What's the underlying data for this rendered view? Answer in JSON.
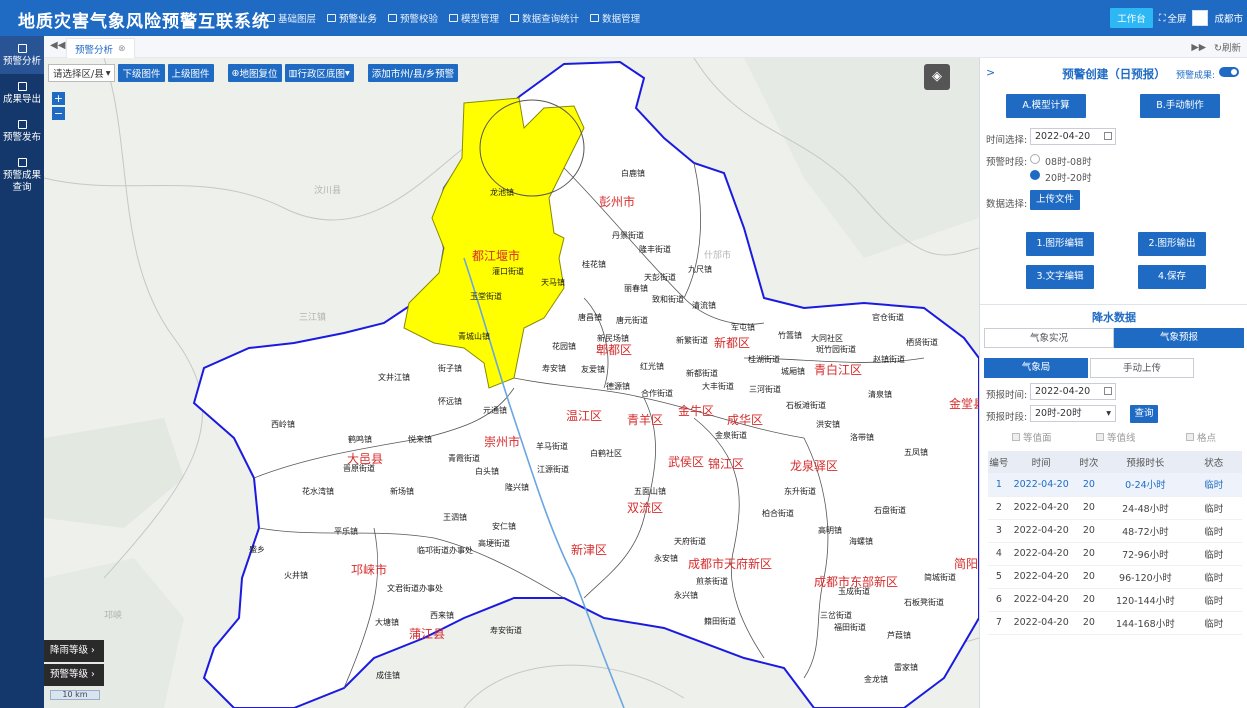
{
  "header": {
    "title": "地质灾害气象风险预警互联系统",
    "nav": [
      {
        "label": "基础图层",
        "icon": "layers-icon"
      },
      {
        "label": "预警业务",
        "icon": "chart-icon",
        "active": true
      },
      {
        "label": "预警校验",
        "icon": "document-icon"
      },
      {
        "label": "模型管理",
        "icon": "model-icon"
      },
      {
        "label": "数据查询统计",
        "icon": "query-icon"
      },
      {
        "label": "数据管理",
        "icon": "database-icon"
      }
    ],
    "workbench": "工作台",
    "fullscreen": "全屏",
    "user": "成都市"
  },
  "sidebar": {
    "items": [
      {
        "label": "预警分析",
        "icon": "analysis-icon",
        "active": true
      },
      {
        "label": "成果导出",
        "icon": "export-icon"
      },
      {
        "label": "预警发布",
        "icon": "publish-icon"
      },
      {
        "label": "预警成果查询",
        "icon": "search-result-icon"
      }
    ]
  },
  "tabs": {
    "active": "预警分析",
    "refresh": "刷新"
  },
  "map_toolbar": {
    "region_select": "请选择区/县",
    "down_level": "下级图件",
    "up_level": "上级图件",
    "reset": "地图复位",
    "basemap": "行政区底图",
    "add_warning": "添加市州/县/乡预警"
  },
  "legend": {
    "rain_level": "降雨等级",
    "warning_level": "预警等级",
    "scale": "10 km"
  },
  "map_labels": {
    "cities": [
      "彭州市",
      "都江堰市",
      "郫都区",
      "新都区",
      "青白江区",
      "金堂县",
      "温江区",
      "金牛区",
      "青羊区",
      "成华区",
      "崇州市",
      "大邑县",
      "武侯区",
      "锦江区",
      "龙泉驿区",
      "双流区",
      "新津区",
      "邛崃市",
      "成都市天府新区",
      "成都市东部新区",
      "蒲江县",
      "简阳"
    ],
    "towns": [
      "龙池镇",
      "白鹿镇",
      "丹景街道",
      "隆丰街道",
      "九尺镇",
      "天彭街道",
      "灌口街道",
      "天马镇",
      "玉堂街道",
      "青城山镇",
      "丽春镇",
      "致和街道",
      "桂花镇",
      "清流镇",
      "军屯镇",
      "唐昌镇",
      "唐元街道",
      "新民场镇",
      "花园镇",
      "新繁街道",
      "竹篙镇",
      "大同社区",
      "官仓街道",
      "斑竹园街道",
      "桂湖街道",
      "城厢镇",
      "赵镇街道",
      "栖贤街道",
      "文井江镇",
      "街子镇",
      "寿安镇",
      "友爱镇",
      "红光镇",
      "德源镇",
      "三河街道",
      "大丰街道",
      "新都街道",
      "石板滩街道",
      "清泉镇",
      "怀远镇",
      "元通镇",
      "合作街道",
      "金泉街道",
      "洪安镇",
      "洛带镇",
      "西岭镇",
      "鹤鸣镇",
      "悦来镇",
      "羊马街道",
      "白鹤社区",
      "晋原街道",
      "青霞街道",
      "白头镇",
      "江源街道",
      "新场镇",
      "花水湾镇",
      "王泗镇",
      "隆兴镇",
      "安仁镇",
      "东升街道",
      "柏合街道",
      "平乐镇",
      "临邛街道办事处",
      "文君街道办事处",
      "高埂街道",
      "火井镇",
      "大塘镇",
      "西来镇",
      "寿安街道",
      "成佳镇",
      "永安镇",
      "煎茶街道",
      "籍田街道",
      "天府街道",
      "五凤镇",
      "高明镇",
      "海螺镇",
      "三岔街道",
      "玉成街道",
      "福田街道",
      "芦葭镇",
      "石板凳街道",
      "雷家镇",
      "石盘街道",
      "简城街道",
      "永兴镇",
      "金龙镇",
      "盛乡",
      "五面山镇"
    ],
    "outside": [
      "汶川县",
      "什邡市",
      "三江镇",
      "邛峡"
    ]
  },
  "panel": {
    "title": "预警创建（日预报）",
    "toggle_label": "预警成果:",
    "model_calc": "A.模型计算",
    "manual_make": "B.手动制作",
    "time_label": "时间选择:",
    "date": "2022-04-20",
    "period_label": "预警时段:",
    "periods": [
      "08时-08时",
      "20时-20时"
    ],
    "selected_period": "20时-20时",
    "data_label": "数据选择:",
    "upload": "上传文件",
    "actions": [
      "1.图形编辑",
      "2.图形输出",
      "3.文字编辑",
      "4.保存"
    ],
    "rain_title": "降水数据",
    "rain_tabs": [
      "气象实况",
      "气象预报"
    ],
    "source_tabs": [
      "气象局",
      "手动上传"
    ],
    "forecast_time_label": "预报时间:",
    "forecast_date": "2022-04-20",
    "forecast_period_label": "预报时段:",
    "forecast_period": "20时-20时",
    "query": "查询",
    "checkboxes": [
      "等值面",
      "等值线",
      "格点"
    ],
    "table": {
      "headers": [
        "编号",
        "时间",
        "时次",
        "预报时长",
        "状态"
      ],
      "rows": [
        [
          "1",
          "2022-04-20",
          "20",
          "0-24小时",
          "临时"
        ],
        [
          "2",
          "2022-04-20",
          "20",
          "24-48小时",
          "临时"
        ],
        [
          "3",
          "2022-04-20",
          "20",
          "48-72小时",
          "临时"
        ],
        [
          "4",
          "2022-04-20",
          "20",
          "72-96小时",
          "临时"
        ],
        [
          "5",
          "2022-04-20",
          "20",
          "96-120小时",
          "临时"
        ],
        [
          "6",
          "2022-04-20",
          "20",
          "120-144小时",
          "临时"
        ],
        [
          "7",
          "2022-04-20",
          "20",
          "144-168小时",
          "临时"
        ]
      ]
    }
  },
  "colors": {
    "header": "#1f6bc4",
    "sidebar": "#14386b",
    "boundary": "#1a1ae0",
    "warning_fill": "#ffff00",
    "city_label": "#d62c2c"
  }
}
